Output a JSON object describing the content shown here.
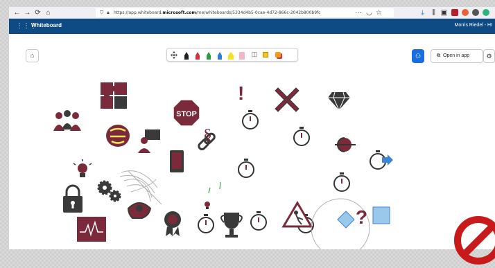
{
  "browser": {
    "back_label": "←",
    "forward_label": "→",
    "reload_label": "⟳",
    "home_label": "⌂",
    "url_prefix": "https://app.whiteboard.",
    "url_domain": "microsoft.com",
    "url_suffix": "/me/whiteboards/5334d4b5-0cae-4d72-866c-2042b800b9fc",
    "more_label": "···"
  },
  "app": {
    "waffle_icon": "⋮⋮⋮",
    "title": "Whiteboard",
    "user": "Morris Riedel - HI"
  },
  "toolbar": {
    "open_in_app": "Open in app",
    "home_icon": "⌂",
    "settings_icon": "⚙"
  },
  "canvas": {
    "stop_text": "STOP",
    "paragraph": "§",
    "question": "?",
    "exclamation": "!"
  },
  "colors": {
    "maroon": "#7a2a3a",
    "dark": "#3a3a3a",
    "accent_blue": "#1a6de0",
    "appbar": "#0e4a84",
    "diamond_blue": "#9ac8ea"
  }
}
